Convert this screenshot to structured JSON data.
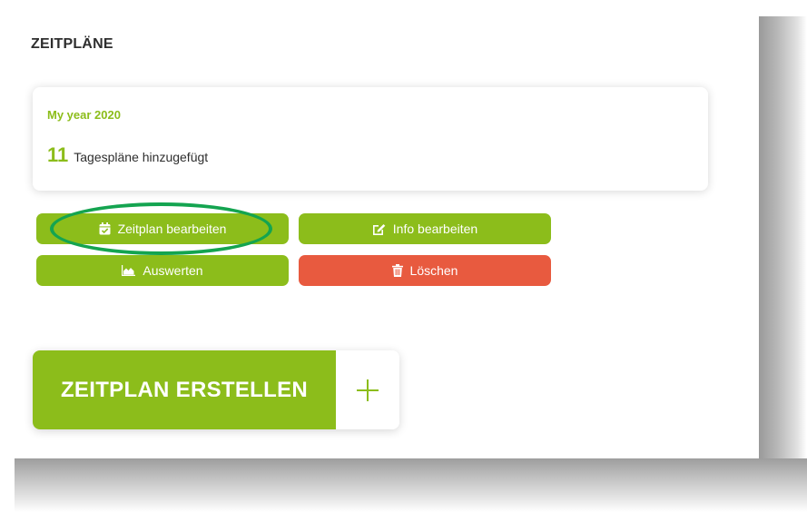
{
  "section": {
    "title": "ZEITPLÄNE"
  },
  "schedule_card": {
    "name": "My year 2020",
    "count": "11",
    "count_label": "Tagespläne hinzugefügt"
  },
  "actions": {
    "edit_plan": {
      "label": "Zeitplan bearbeiten",
      "icon": "calendar-check-icon"
    },
    "edit_info": {
      "label": "Info bearbeiten",
      "icon": "edit-icon"
    },
    "evaluate": {
      "label": "Auswerten",
      "icon": "area-chart-icon"
    },
    "delete": {
      "label": "Löschen",
      "icon": "trash-icon"
    }
  },
  "create": {
    "label": "ZEITPLAN ERSTELLEN",
    "icon": "plus-icon"
  },
  "colors": {
    "accent": "#8cbd1b",
    "danger": "#e85a3f",
    "highlight": "#14a450",
    "text": "#2e2e2e"
  }
}
